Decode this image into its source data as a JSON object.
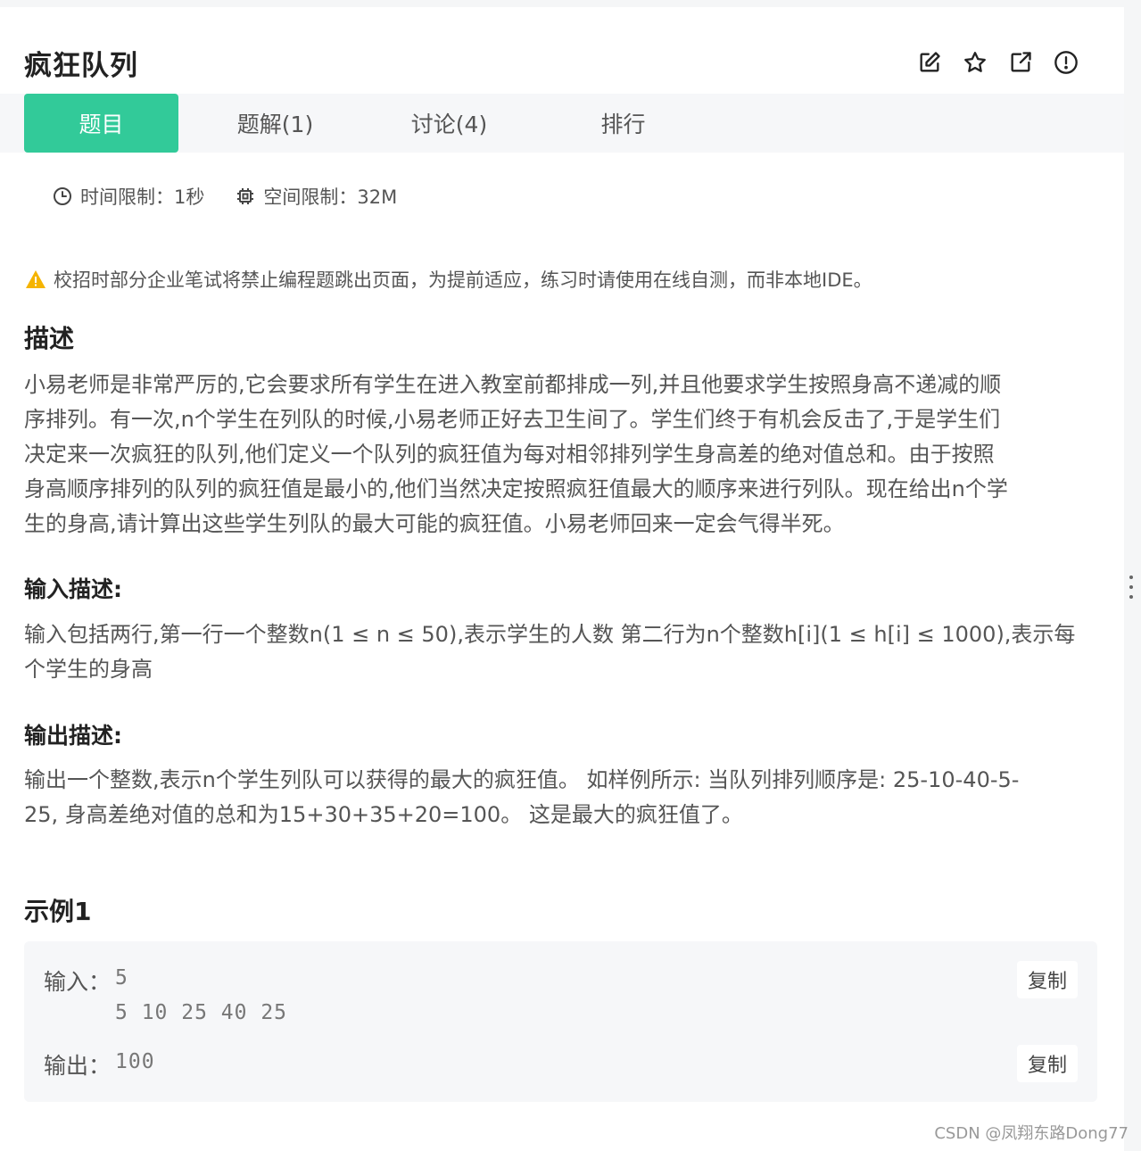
{
  "header": {
    "title": "疯狂队列"
  },
  "icons": {
    "edit": "edit-icon",
    "star": "star-icon",
    "share": "external-link-icon",
    "report": "alert-circle-icon"
  },
  "tabs": [
    {
      "label": "题目",
      "active": true
    },
    {
      "label": "题解(1)",
      "active": false
    },
    {
      "label": "讨论(4)",
      "active": false
    },
    {
      "label": "排行",
      "active": false
    }
  ],
  "limits": {
    "time": "时间限制：1秒",
    "space": "空间限制：32M"
  },
  "notice": "校招时部分企业笔试将禁止编程题跳出页面，为提前适应，练习时请使用在线自测，而非本地IDE。",
  "description": {
    "heading": "描述",
    "lines": [
      "小易老师是非常严厉的,它会要求所有学生在进入教室前都排成一列,并且他要求学生按照身高不递减的顺",
      "序排列。有一次,n个学生在列队的时候,小易老师正好去卫生间了。学生们终于有机会反击了,于是学生们",
      "决定来一次疯狂的队列,他们定义一个队列的疯狂值为每对相邻排列学生身高差的绝对值总和。由于按照",
      "身高顺序排列的队列的疯狂值是最小的,他们当然决定按照疯狂值最大的顺序来进行列队。现在给出n个学",
      "生的身高,请计算出这些学生列队的最大可能的疯狂值。小易老师回来一定会气得半死。"
    ]
  },
  "input_desc": {
    "heading": "输入描述:",
    "lines": [
      "输入包括两行,第一行一个整数n(1 ≤ n ≤ 50),表示学生的人数 第二行为n个整数h[i](1 ≤ h[i] ≤ 1000),表示每",
      "个学生的身高"
    ]
  },
  "output_desc": {
    "heading": "输出描述:",
    "lines": [
      "输出一个整数,表示n个学生列队可以获得的最大的疯狂值。 如样例所示: 当队列排列顺序是: 25-10-40-5-",
      "25, 身高差绝对值的总和为15+30+35+20=100。 这是最大的疯狂值了。"
    ]
  },
  "example": {
    "heading": "示例1",
    "input_label": "输入：",
    "input_lines": [
      "5",
      "5 10 25 40 25"
    ],
    "output_label": "输出：",
    "output_value": "100",
    "copy_label": "复制"
  },
  "watermark": "CSDN @凤翔东路Dong77"
}
